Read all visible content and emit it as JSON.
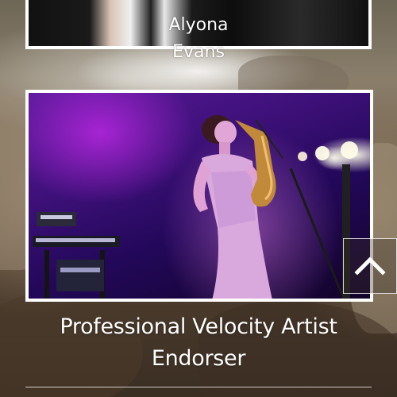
{
  "top_card": {
    "caption_line1": "Alyona",
    "caption_line2": "Evans"
  },
  "main_card": {
    "photo_alt": "Saxophonist performing on stage"
  },
  "headline": {
    "line1": "Professional Velocity Artist",
    "line2": "Endorser"
  },
  "scroll_top": {
    "icon": "chevron-up-icon"
  },
  "colors": {
    "text": "#ffffff",
    "frame_border": "#ffffff",
    "stage_purple": "#5a1a9a"
  }
}
